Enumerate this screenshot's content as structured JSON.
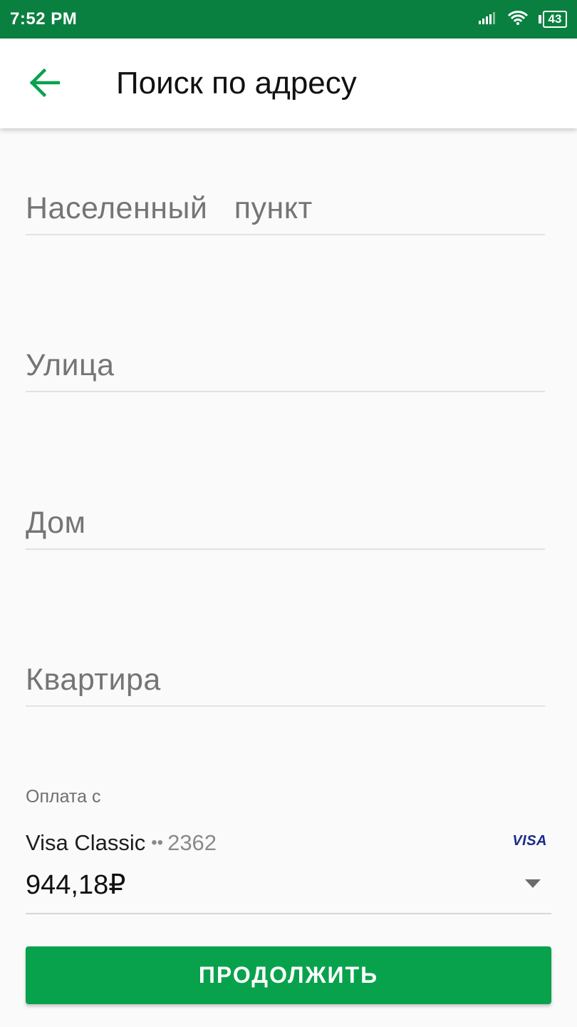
{
  "status_bar": {
    "time": "7:52 PM",
    "battery_level": "43",
    "icons": [
      "signal-icon",
      "wifi-icon",
      "battery-icon"
    ]
  },
  "app_bar": {
    "title": "Поиск по адресу",
    "back_icon": "arrow-left-icon"
  },
  "form": {
    "settlement_placeholder": "Населенный   пункт",
    "street_placeholder": "Улица",
    "house_placeholder": "Дом",
    "apartment_placeholder": "Квартира"
  },
  "payment": {
    "caption": "Оплата с",
    "card_name": "Visa Classic",
    "card_dots": "••",
    "card_number": "2362",
    "card_brand": "VISA",
    "amount": "944,18₽"
  },
  "actions": {
    "continue_label": "ПРОДОЛЖИТЬ"
  },
  "colors": {
    "status_bar": "#0a8040",
    "accent": "#08a24d",
    "visa_blue": "#1a2b8a"
  }
}
